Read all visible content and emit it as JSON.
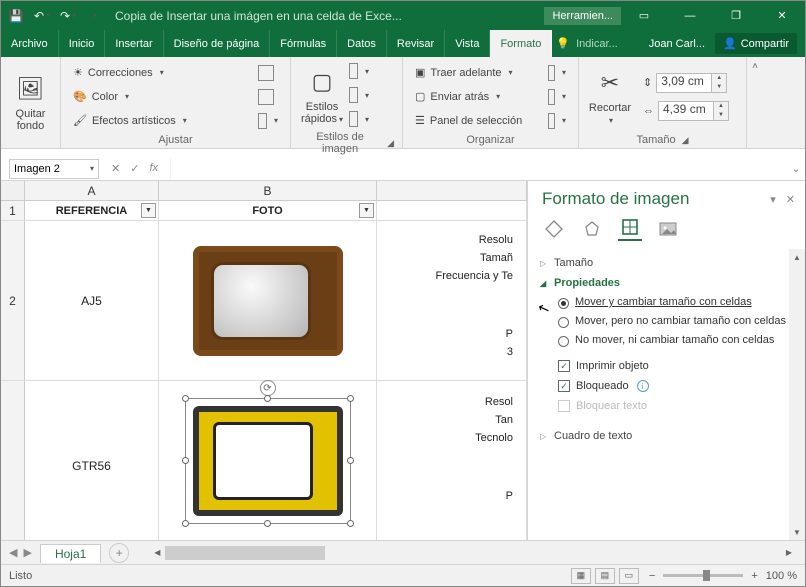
{
  "title": "Copia de Insertar una imágen en una celda de Exce...",
  "context_tab": "Herramien...",
  "user": "Joan Carl...",
  "share": "Compartir",
  "menu": {
    "file": "Archivo",
    "home": "Inicio",
    "insert": "Insertar",
    "layout": "Diseño de página",
    "formulas": "Fórmulas",
    "data": "Datos",
    "review": "Revisar",
    "view": "Vista",
    "format": "Formato",
    "tell": "Indicar..."
  },
  "ribbon": {
    "remove_bg_l1": "Quitar",
    "remove_bg_l2": "fondo",
    "corrections": "Correcciones",
    "color": "Color",
    "effects": "Efectos artísticos",
    "adjust_lbl": "Ajustar",
    "styles_l1": "Estilos",
    "styles_l2": "rápidos",
    "styles_lbl": "Estilos de imagen",
    "bring_fwd": "Traer adelante",
    "send_back": "Enviar atrás",
    "sel_pane": "Panel de selección",
    "organize_lbl": "Organizar",
    "crop": "Recortar",
    "size_lbl": "Tamaño",
    "h": "3,09 cm",
    "w": "4,39 cm"
  },
  "namebox": "Imagen 2",
  "fx": "fx",
  "cols": {
    "A": "A",
    "B": "B"
  },
  "headers": {
    "ref": "REFERENCIA",
    "foto": "FOTO"
  },
  "rows": [
    "1",
    "2"
  ],
  "data": {
    "r1_ref": "AJ5",
    "r2_ref": "GTR56"
  },
  "side_text": {
    "a": "Resolu",
    "b": "Tamañ",
    "c": "Frecuencia y Te",
    "d": "P",
    "e": "3",
    "f": "Resol",
    "g": "Tan",
    "h": "Tecnolo",
    "i": "P"
  },
  "pane": {
    "title": "Formato de imagen",
    "size": "Tamaño",
    "props": "Propiedades",
    "opt1": "Mover y cambiar tamaño con celdas",
    "opt2": "Mover, pero no cambiar tamaño con celdas",
    "opt3": "No mover, ni cambiar tamaño con celdas",
    "print": "Imprimir objeto",
    "locked": "Bloqueado",
    "lock_text": "Bloquear texto",
    "textbox": "Cuadro de texto"
  },
  "sheet": "Hoja1",
  "status": "Listo",
  "zoom": "100 %"
}
